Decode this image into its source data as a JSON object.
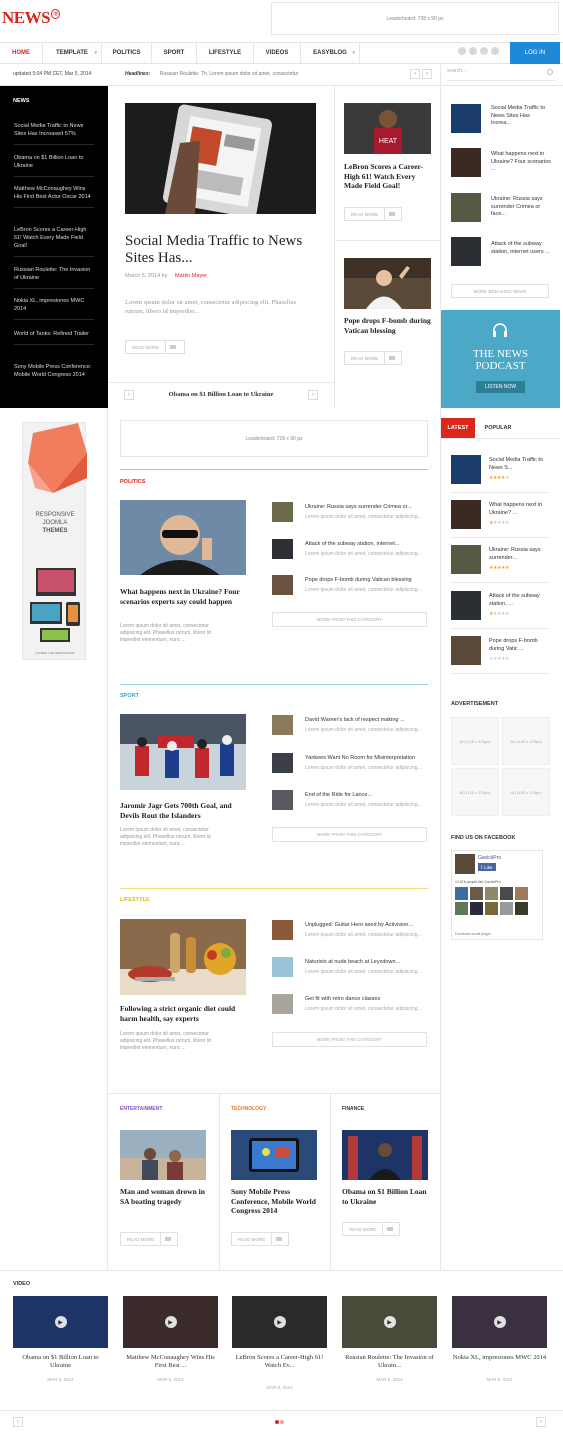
{
  "header": {
    "logo": "NEWS",
    "logo_mark": "®",
    "leaderboard": "Leaderboard: 728 x 90 px"
  },
  "nav": {
    "items": [
      {
        "label": "HOME"
      },
      {
        "label": "TEMPLATE"
      },
      {
        "label": "POLITICS"
      },
      {
        "label": "SPORT"
      },
      {
        "label": "LIFESTYLE"
      },
      {
        "label": "VIDEOS"
      },
      {
        "label": "EASYBLOG"
      }
    ],
    "login": "LOG IN"
  },
  "subbar": {
    "updated": "updated 5:04 PM CET, Mar 5, 2014",
    "headlines_label": "Headlines:",
    "headline": "Russian Roulette: Th. Lorem ipsum dolor sit amet, consectetur",
    "search_placeholder": "search..."
  },
  "news_sidebar": {
    "title": "NEWS",
    "items": [
      "Social Media Traffic to News Sites Has Increased 57%",
      "Obama on $1 Billion Loan to Ukraine",
      "Matthew McConaughey Wins His First Best Actor Oscar 2014",
      "LeBron Scores a Career-High 61! Watch Every Made Field Goal!",
      "Russian Roulette: The Invasion of Ukraine",
      "Nokia XL, impresiones MWC 2014",
      "World of Tanks: Refined Trailer",
      "Sony Mobile Press Conference: Mobile World Congress 2014"
    ]
  },
  "featured": {
    "title": "Social Media Traffic to News Sites Has...",
    "date": "March 5, 2014 by",
    "author": "Martin Mayer",
    "excerpt": "Lorem ipsum dolor sit amet, consectetur adipiscing elit. Phasellus rutrum, libero id imperdiet...",
    "read_more": "READ MORE",
    "slider_text": "Obama on $1 Billion Loan to Ukraine"
  },
  "side_cards": [
    {
      "title": "LeBron Scores a Career-High 61! Watch Every Made Field Goal!",
      "read_more": "READ MORE"
    },
    {
      "title": "Pope drops F-bomb during Vatican blessing",
      "read_more": "READ MORE"
    }
  ],
  "breaking": {
    "items": [
      "Social Media Traffic to News Sites Has Increa...",
      "What happens next in Ukraine? Four scenarios ...",
      "Ukraine: Russia says surrender Crimea or face...",
      "Attack of the subway station, internet users ..."
    ],
    "more": "MORE BREAKING NEWS"
  },
  "podcast": {
    "title": "THE NEWS PODCAST",
    "button": "LISTEN NOW"
  },
  "left_ad": {
    "line1": "RESPONSIVE",
    "line2": "JOOMLA",
    "line3": "THEMES",
    "footer": "GLOBAL THE RESPONSIVE"
  },
  "leaderboard_mid": "Leaderboard: 728 x 90 px",
  "categories": [
    {
      "name": "POLITICS",
      "color": "#d9271c",
      "main_title": "What happens next in Ukraine? Four scenarios experts say could happen",
      "main_ex": "Lorem ipsum dolor sit amet, consectetur adipiscing elit. Phasellus rutrum, libero id imperdiet elementum, nunc ...",
      "list": [
        {
          "title": "Ukraine: Russia says surrender Crimea or...",
          "ex": "Lorem ipsum dolor sit amet, consectetur adipiscing..."
        },
        {
          "title": "Attack of the subway station, internet...",
          "ex": "Lorem ipsum dolor sit amet, consectetur adipiscing..."
        },
        {
          "title": "Pope drops F-bomb during Vatican blessing",
          "ex": "Lorem ipsum dolor sit amet, consectetur adipiscing..."
        }
      ],
      "more": "MORE FROM THIS CATEGORY"
    },
    {
      "name": "SPORT",
      "color": "#3aa0c7",
      "main_title": "Jaromir Jagr Gets 700th Goal, and Devils Rout the Islanders",
      "main_ex": "Lorem ipsum dolor sit amet, consectetur adipiscing elit. Phasellus rutrum, libero id imperdiet elementum, nunc ...",
      "list": [
        {
          "title": "David Warner's lack of respect making ...",
          "ex": "Lorem ipsum dolor sit amet, consectetur adipiscing..."
        },
        {
          "title": "Yankees Want No Room for Misinterpretation",
          "ex": "Lorem ipsum dolor sit amet, consectetur adipiscing..."
        },
        {
          "title": "End of the Ride for Lance...",
          "ex": "Lorem ipsum dolor sit amet, consectetur adipiscing..."
        }
      ],
      "more": "MORE FROM THIS CATEGORY"
    },
    {
      "name": "LIFESTYLE",
      "color": "#e6b800",
      "main_title": "Following a strict organic diet could harm health, say experts",
      "main_ex": "Lorem ipsum dolor sit amet, consectetur adipiscing elit. Phasellus rutrum, libero id imperdiet elementum, nunc ...",
      "list": [
        {
          "title": "Unplugged: Guitar Hero axed by Activision...",
          "ex": "Lorem ipsum dolor sit amet, consectetur adipiscing..."
        },
        {
          "title": "Naturists at nude beach at Leysdown...",
          "ex": "Lorem ipsum dolor sit amet, consectetur adipiscing..."
        },
        {
          "title": "Get fit with retro dance classes",
          "ex": "Lorem ipsum dolor sit amet, consectetur adipiscing..."
        }
      ],
      "more": "MORE FROM THIS CATEGORY"
    }
  ],
  "bottom_cols": [
    {
      "name": "ENTERTAINMENT",
      "color": "#8a4fbf",
      "title": "Man and woman drown in SA boating tragedy",
      "read_more": "READ MORE"
    },
    {
      "name": "TECHNOLOGY",
      "color": "#e37b1b",
      "title": "Sony Mobile Press Conference, Mobile World Congress 2014",
      "read_more": "READ MORE"
    },
    {
      "name": "FINANCE",
      "color": "#333333",
      "title": "Obama on $1 Billion Loan to Ukraine",
      "read_more": "READ MORE"
    }
  ],
  "tabs": {
    "latest": "LATEST",
    "popular": "POPULAR",
    "items": [
      {
        "title": "Social Media Traffic to News S...",
        "stars": 4
      },
      {
        "title": "What happens next in Ukraine? ...",
        "stars": 1
      },
      {
        "title": "Ukraine: Russia says surrender...",
        "stars": 5
      },
      {
        "title": "Attack of the subway station, ...",
        "stars": 1
      },
      {
        "title": "Pope drops F-bomb during Vatic ...",
        "stars": 0
      }
    ]
  },
  "advertisement": {
    "title": "ADVERTISEMENT",
    "box": "AD (125 x 125px)"
  },
  "facebook": {
    "title": "FIND US ON FACEBOOK",
    "page": "GavickPro",
    "like": "Like",
    "count": "12,876 people like GavickPro.",
    "plugin": "Facebook social plugin"
  },
  "video": {
    "title": "VIDEO",
    "items": [
      {
        "title": "Obama on $1 Billion Loan to Ukraine",
        "date": "MAR 5, 2014"
      },
      {
        "title": "Matthew McConaughey Wins His First Best ...",
        "date": "MAR 5, 2014"
      },
      {
        "title": "LeBron Scores a Career-High 61! Watch Ev...",
        "date": "MAR 5, 2014"
      },
      {
        "title": "Russian Roulette: The Invasion of Ukrain...",
        "date": "MAR 5, 2014"
      },
      {
        "title": "Nokia XL, impresiones MWC 2014",
        "date": "MAR 5, 2014"
      }
    ]
  }
}
